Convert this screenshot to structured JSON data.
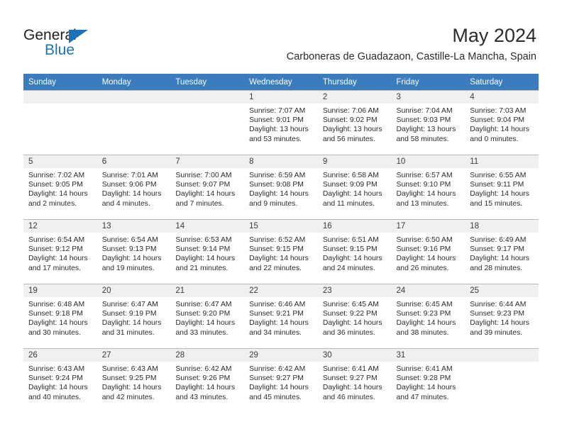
{
  "logo": {
    "word_top": "General",
    "word_bottom": "Blue",
    "triangle_color": "#1b72b8",
    "icon": "triangle-icon"
  },
  "header": {
    "title": "May 2024",
    "subtitle": "Carboneras de Guadazaon, Castille-La Mancha, Spain"
  },
  "colors": {
    "header_row_bg": "#3a7cbe",
    "header_row_text": "#ffffff",
    "daynum_band_bg": "#f0f0f0",
    "cell_border": "#b9b9b9",
    "brand_blue": "#1b72b8"
  },
  "weekdays": [
    "Sunday",
    "Monday",
    "Tuesday",
    "Wednesday",
    "Thursday",
    "Friday",
    "Saturday"
  ],
  "weeks": [
    [
      {
        "day": "",
        "lines": []
      },
      {
        "day": "",
        "lines": []
      },
      {
        "day": "",
        "lines": []
      },
      {
        "day": "1",
        "lines": [
          "Sunrise: 7:07 AM",
          "Sunset: 9:01 PM",
          "Daylight: 13 hours",
          "and 53 minutes."
        ]
      },
      {
        "day": "2",
        "lines": [
          "Sunrise: 7:06 AM",
          "Sunset: 9:02 PM",
          "Daylight: 13 hours",
          "and 56 minutes."
        ]
      },
      {
        "day": "3",
        "lines": [
          "Sunrise: 7:04 AM",
          "Sunset: 9:03 PM",
          "Daylight: 13 hours",
          "and 58 minutes."
        ]
      },
      {
        "day": "4",
        "lines": [
          "Sunrise: 7:03 AM",
          "Sunset: 9:04 PM",
          "Daylight: 14 hours",
          "and 0 minutes."
        ]
      }
    ],
    [
      {
        "day": "5",
        "lines": [
          "Sunrise: 7:02 AM",
          "Sunset: 9:05 PM",
          "Daylight: 14 hours",
          "and 2 minutes."
        ]
      },
      {
        "day": "6",
        "lines": [
          "Sunrise: 7:01 AM",
          "Sunset: 9:06 PM",
          "Daylight: 14 hours",
          "and 4 minutes."
        ]
      },
      {
        "day": "7",
        "lines": [
          "Sunrise: 7:00 AM",
          "Sunset: 9:07 PM",
          "Daylight: 14 hours",
          "and 7 minutes."
        ]
      },
      {
        "day": "8",
        "lines": [
          "Sunrise: 6:59 AM",
          "Sunset: 9:08 PM",
          "Daylight: 14 hours",
          "and 9 minutes."
        ]
      },
      {
        "day": "9",
        "lines": [
          "Sunrise: 6:58 AM",
          "Sunset: 9:09 PM",
          "Daylight: 14 hours",
          "and 11 minutes."
        ]
      },
      {
        "day": "10",
        "lines": [
          "Sunrise: 6:57 AM",
          "Sunset: 9:10 PM",
          "Daylight: 14 hours",
          "and 13 minutes."
        ]
      },
      {
        "day": "11",
        "lines": [
          "Sunrise: 6:55 AM",
          "Sunset: 9:11 PM",
          "Daylight: 14 hours",
          "and 15 minutes."
        ]
      }
    ],
    [
      {
        "day": "12",
        "lines": [
          "Sunrise: 6:54 AM",
          "Sunset: 9:12 PM",
          "Daylight: 14 hours",
          "and 17 minutes."
        ]
      },
      {
        "day": "13",
        "lines": [
          "Sunrise: 6:54 AM",
          "Sunset: 9:13 PM",
          "Daylight: 14 hours",
          "and 19 minutes."
        ]
      },
      {
        "day": "14",
        "lines": [
          "Sunrise: 6:53 AM",
          "Sunset: 9:14 PM",
          "Daylight: 14 hours",
          "and 21 minutes."
        ]
      },
      {
        "day": "15",
        "lines": [
          "Sunrise: 6:52 AM",
          "Sunset: 9:15 PM",
          "Daylight: 14 hours",
          "and 22 minutes."
        ]
      },
      {
        "day": "16",
        "lines": [
          "Sunrise: 6:51 AM",
          "Sunset: 9:15 PM",
          "Daylight: 14 hours",
          "and 24 minutes."
        ]
      },
      {
        "day": "17",
        "lines": [
          "Sunrise: 6:50 AM",
          "Sunset: 9:16 PM",
          "Daylight: 14 hours",
          "and 26 minutes."
        ]
      },
      {
        "day": "18",
        "lines": [
          "Sunrise: 6:49 AM",
          "Sunset: 9:17 PM",
          "Daylight: 14 hours",
          "and 28 minutes."
        ]
      }
    ],
    [
      {
        "day": "19",
        "lines": [
          "Sunrise: 6:48 AM",
          "Sunset: 9:18 PM",
          "Daylight: 14 hours",
          "and 30 minutes."
        ]
      },
      {
        "day": "20",
        "lines": [
          "Sunrise: 6:47 AM",
          "Sunset: 9:19 PM",
          "Daylight: 14 hours",
          "and 31 minutes."
        ]
      },
      {
        "day": "21",
        "lines": [
          "Sunrise: 6:47 AM",
          "Sunset: 9:20 PM",
          "Daylight: 14 hours",
          "and 33 minutes."
        ]
      },
      {
        "day": "22",
        "lines": [
          "Sunrise: 6:46 AM",
          "Sunset: 9:21 PM",
          "Daylight: 14 hours",
          "and 34 minutes."
        ]
      },
      {
        "day": "23",
        "lines": [
          "Sunrise: 6:45 AM",
          "Sunset: 9:22 PM",
          "Daylight: 14 hours",
          "and 36 minutes."
        ]
      },
      {
        "day": "24",
        "lines": [
          "Sunrise: 6:45 AM",
          "Sunset: 9:23 PM",
          "Daylight: 14 hours",
          "and 38 minutes."
        ]
      },
      {
        "day": "25",
        "lines": [
          "Sunrise: 6:44 AM",
          "Sunset: 9:23 PM",
          "Daylight: 14 hours",
          "and 39 minutes."
        ]
      }
    ],
    [
      {
        "day": "26",
        "lines": [
          "Sunrise: 6:43 AM",
          "Sunset: 9:24 PM",
          "Daylight: 14 hours",
          "and 40 minutes."
        ]
      },
      {
        "day": "27",
        "lines": [
          "Sunrise: 6:43 AM",
          "Sunset: 9:25 PM",
          "Daylight: 14 hours",
          "and 42 minutes."
        ]
      },
      {
        "day": "28",
        "lines": [
          "Sunrise: 6:42 AM",
          "Sunset: 9:26 PM",
          "Daylight: 14 hours",
          "and 43 minutes."
        ]
      },
      {
        "day": "29",
        "lines": [
          "Sunrise: 6:42 AM",
          "Sunset: 9:27 PM",
          "Daylight: 14 hours",
          "and 45 minutes."
        ]
      },
      {
        "day": "30",
        "lines": [
          "Sunrise: 6:41 AM",
          "Sunset: 9:27 PM",
          "Daylight: 14 hours",
          "and 46 minutes."
        ]
      },
      {
        "day": "31",
        "lines": [
          "Sunrise: 6:41 AM",
          "Sunset: 9:28 PM",
          "Daylight: 14 hours",
          "and 47 minutes."
        ]
      },
      {
        "day": "",
        "lines": []
      }
    ]
  ]
}
